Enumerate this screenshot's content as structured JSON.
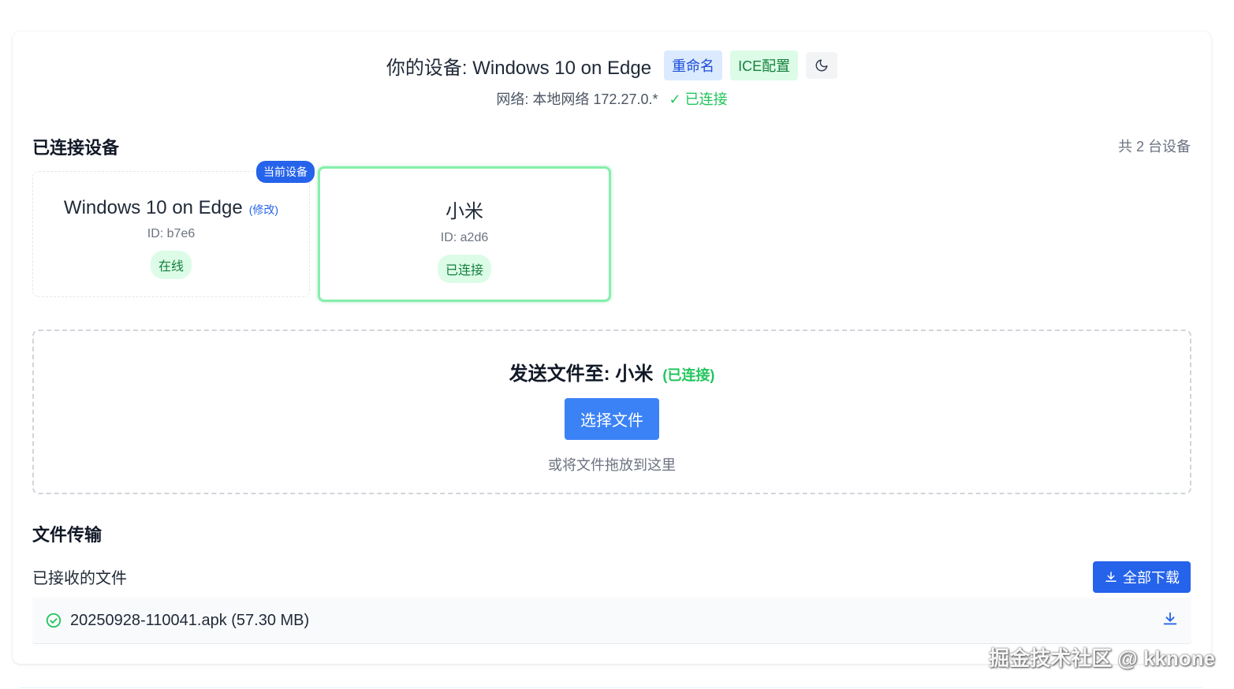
{
  "header": {
    "device_title": "你的设备: Windows 10 on Edge",
    "rename_label": "重命名",
    "ice_label": "ICE配置",
    "theme_icon": "moon-icon"
  },
  "network": {
    "text": "网络: 本地网络 172.27.0.*",
    "status": "✓ 已连接"
  },
  "connected_devices": {
    "title": "已连接设备",
    "count_text": "共 2 台设备",
    "current_badge": "当前设备",
    "devices": [
      {
        "name": "Windows 10 on Edge",
        "edit_label": "(修改)",
        "id": "ID: b7e6",
        "status": "在线"
      },
      {
        "name": "小米",
        "id": "ID: a2d6",
        "status": "已连接"
      }
    ]
  },
  "send": {
    "title": "发送文件至: 小米",
    "status": "(已连接)",
    "choose_label": "选择文件",
    "hint": "或将文件拖放到这里"
  },
  "transfer": {
    "title": "文件传输",
    "received_label": "已接收的文件",
    "download_all_label": "全部下载",
    "files": [
      {
        "name": "20250928-110041.apk (57.30 MB)",
        "status_icon": "check-circle-icon"
      }
    ]
  },
  "watermark": "掘金技术社区 @ kknone",
  "colors": {
    "accent": "#3b82f6",
    "primary": "#2563eb",
    "success": "#22c55e",
    "success_bg": "#dcfce7"
  }
}
